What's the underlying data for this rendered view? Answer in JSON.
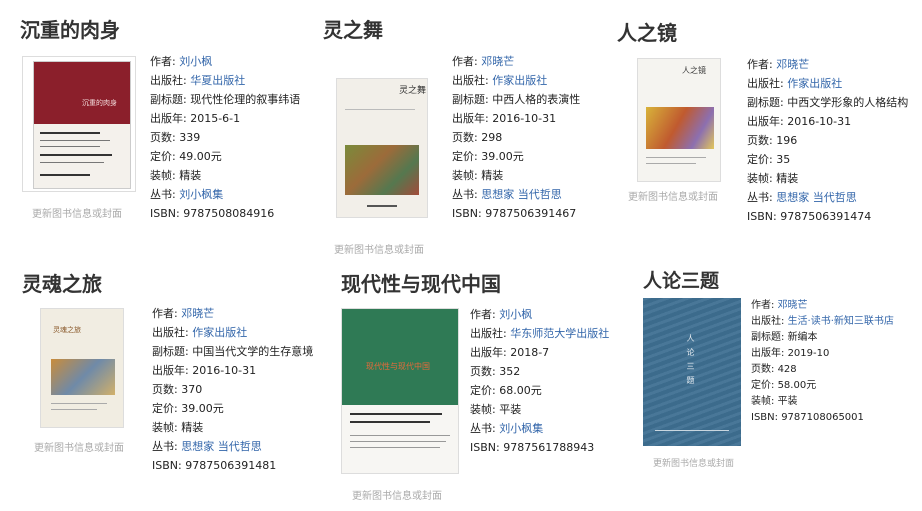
{
  "update_label": "更新图书信息或封面",
  "books": [
    {
      "title": "沉重的肉身",
      "cover_text": "沉重的肉身",
      "author_label": "作者: ",
      "author": "刘小枫",
      "publisher_label": "出版社: ",
      "publisher": "华夏出版社",
      "subtitle_label": "副标题: ",
      "subtitle": "现代性伦理的叙事纬语",
      "year_label": "出版年: ",
      "year": "2015-6-1",
      "pages_label": "页数: ",
      "pages": "339",
      "price_label": "定价: ",
      "price": "49.00元",
      "binding_label": "装帧: ",
      "binding": "精装",
      "series_label": "丛书: ",
      "series": [
        "刘小枫集"
      ],
      "isbn_label": "ISBN: ",
      "isbn": "9787508084916"
    },
    {
      "title": "灵之舞",
      "cover_text": "灵之舞",
      "author_label": "作者: ",
      "author": "邓晓芒",
      "publisher_label": "出版社: ",
      "publisher": "作家出版社",
      "subtitle_label": "副标题: ",
      "subtitle": "中西人格的表演性",
      "year_label": "出版年: ",
      "year": "2016-10-31",
      "pages_label": "页数: ",
      "pages": "298",
      "price_label": "定价: ",
      "price": "39.00元",
      "binding_label": "装帧: ",
      "binding": "精装",
      "series_label": "丛书: ",
      "series": [
        "思想家",
        "当代哲思"
      ],
      "isbn_label": "ISBN: ",
      "isbn": "9787506391467"
    },
    {
      "title": "人之镜",
      "cover_text": "人之镜",
      "author_label": "作者: ",
      "author": "邓晓芒",
      "publisher_label": "出版社: ",
      "publisher": "作家出版社",
      "subtitle_label": "副标题: ",
      "subtitle": "中西文学形象的人格结构",
      "year_label": "出版年: ",
      "year": "2016-10-31",
      "pages_label": "页数: ",
      "pages": "196",
      "price_label": "定价: ",
      "price": "35",
      "binding_label": "装帧: ",
      "binding": "精装",
      "series_label": "丛书: ",
      "series": [
        "思想家",
        "当代哲思"
      ],
      "isbn_label": "ISBN: ",
      "isbn": "9787506391474"
    },
    {
      "title": "灵魂之旅",
      "cover_text": "灵魂之旅",
      "author_label": "作者: ",
      "author": "邓晓芒",
      "publisher_label": "出版社: ",
      "publisher": "作家出版社",
      "subtitle_label": "副标题: ",
      "subtitle": "中国当代文学的生存意境",
      "year_label": "出版年: ",
      "year": "2016-10-31",
      "pages_label": "页数: ",
      "pages": "370",
      "price_label": "定价: ",
      "price": "39.00元",
      "binding_label": "装帧: ",
      "binding": "精装",
      "series_label": "丛书: ",
      "series": [
        "思想家",
        "当代哲思"
      ],
      "isbn_label": "ISBN: ",
      "isbn": "9787506391481"
    },
    {
      "title": "现代性与现代中国",
      "cover_text": "现代性与现代中国",
      "author_label": "作者: ",
      "author": "刘小枫",
      "publisher_label": "出版社: ",
      "publisher": "华东师范大学出版社",
      "year_label": "出版年: ",
      "year": "2018-7",
      "pages_label": "页数: ",
      "pages": "352",
      "price_label": "定价: ",
      "price": "68.00元",
      "binding_label": "装帧: ",
      "binding": "平装",
      "series_label": "丛书: ",
      "series": [
        "刘小枫集"
      ],
      "isbn_label": "ISBN: ",
      "isbn": "9787561788943"
    },
    {
      "title": "人论三题",
      "cover_text": "人论三题",
      "author_label": "作者: ",
      "author": "邓晓芒",
      "publisher_label": "出版社: ",
      "publisher": "生活·读书·新知三联书店",
      "subtitle_label": "副标题: ",
      "subtitle": "新编本",
      "year_label": "出版年: ",
      "year": "2019-10",
      "pages_label": "页数: ",
      "pages": "428",
      "price_label": "定价: ",
      "price": "58.00元",
      "binding_label": "装帧: ",
      "binding": "平装",
      "isbn_label": "ISBN: ",
      "isbn": "9787108065001"
    }
  ]
}
